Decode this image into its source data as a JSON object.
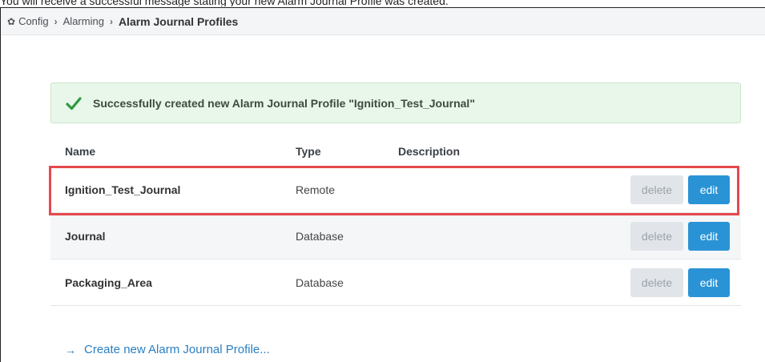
{
  "intro_text": "You will receive a successful message stating your new Alarm Journal Profile was created.",
  "breadcrumb": {
    "icon": "gear-icon",
    "items": [
      "Config",
      "Alarming"
    ],
    "separator": "›",
    "current": "Alarm Journal Profiles"
  },
  "alert": {
    "icon": "check-icon",
    "message": "Successfully created new Alarm Journal Profile \"Ignition_Test_Journal\""
  },
  "table": {
    "headers": {
      "name": "Name",
      "type": "Type",
      "description": "Description"
    },
    "rows": [
      {
        "name": "Ignition_Test_Journal",
        "type": "Remote",
        "description": "",
        "delete_label": "delete",
        "edit_label": "edit"
      },
      {
        "name": "Journal",
        "type": "Database",
        "description": "",
        "delete_label": "delete",
        "edit_label": "edit"
      },
      {
        "name": "Packaging_Area",
        "type": "Database",
        "description": "",
        "delete_label": "delete",
        "edit_label": "edit"
      }
    ]
  },
  "create_link": {
    "arrow": "→",
    "label": "Create new Alarm Journal Profile..."
  },
  "colors": {
    "accent": "#2a93d5",
    "success_bg": "#e9f6ea",
    "success_check": "#2e9a3e",
    "highlight_border": "#e5484d"
  }
}
